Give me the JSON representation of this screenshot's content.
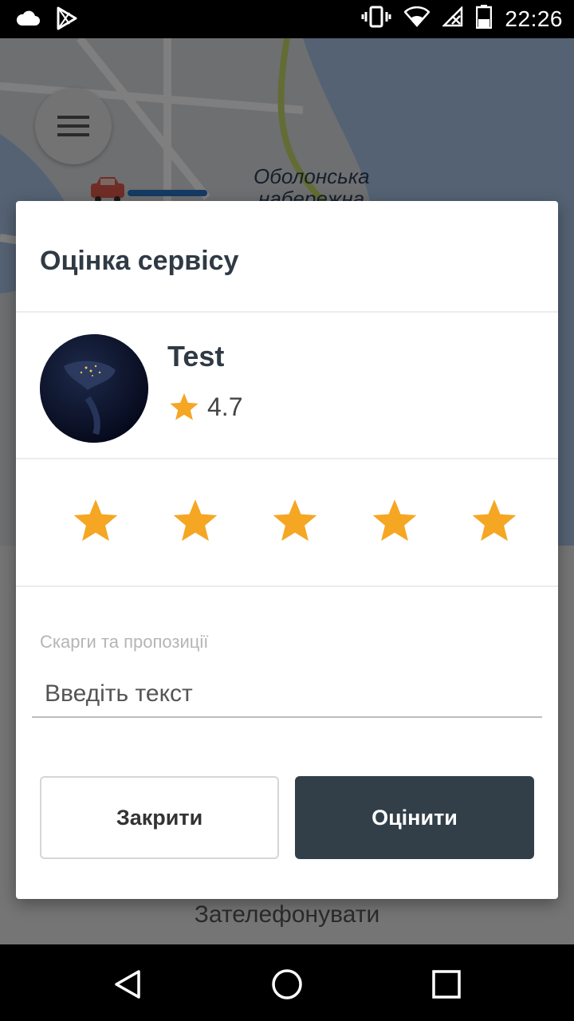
{
  "status_bar": {
    "time": "22:26",
    "icons_left": [
      "cloud-icon",
      "play-store-icon"
    ],
    "icons_right": [
      "vibrate-icon",
      "wifi-icon",
      "no-signal-icon",
      "battery-icon"
    ]
  },
  "map": {
    "street_label_line1": "Оболонська",
    "street_label_line2": "набережна"
  },
  "background": {
    "call_label": "Зателефонувати"
  },
  "dialog": {
    "title": "Оцінка сервісу",
    "driver": {
      "name": "Test",
      "rating": "4.7"
    },
    "stars_selected": 5,
    "stars_total": 5,
    "complaints_label": "Скарги та пропозиції",
    "input_placeholder": "Введіть текст",
    "close_label": "Закрити",
    "rate_label": "Оцінити"
  },
  "colors": {
    "star": "#f5a623",
    "primary_button": "#323f48"
  }
}
